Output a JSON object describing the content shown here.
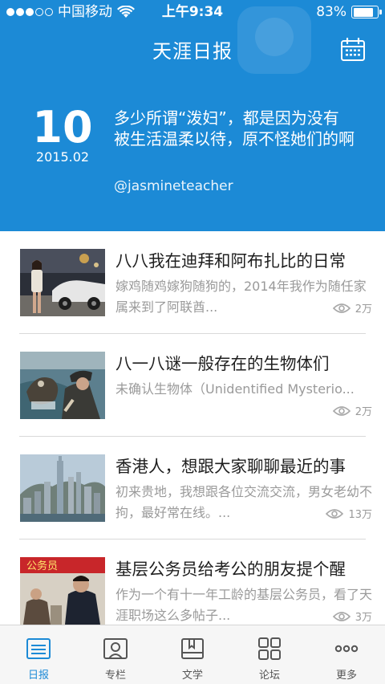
{
  "status_bar": {
    "carrier": "中国移动",
    "time": "上午9:34",
    "battery": "83%",
    "battery_level": 0.83,
    "signal_bars_filled": 3,
    "signal_bars_total": 5
  },
  "header": {
    "title": "天涯日报",
    "background_color": "#1c8ad6",
    "calendar_icon": "calendar-icon"
  },
  "daily": {
    "day": "10",
    "month": "2015.02",
    "quote": "多少所谓“泼妇”，都是因为没有被生活温柔以待，原不怪她们的啊",
    "author": "@jasmineteacher"
  },
  "articles": [
    {
      "title": "八八我在迪拜和阿布扎比的日常",
      "summary": "嫁鸡随鸡嫁狗随狗的，2014年我作为随任家属来到了阿联酋...",
      "views": "2万"
    },
    {
      "title": "八一八谜一般存在的生物体们",
      "summary": "未确认生物体（Unidentified Mysterio...",
      "views": "2万"
    },
    {
      "title": "香港人，想跟大家聊聊最近的事",
      "summary": "初来贵地，我想跟各位交流交流，男女老幼不拘，最好常在线。...",
      "views": "13万"
    },
    {
      "title": "基层公务员给考公的朋友提个醒",
      "summary": "作为一个有十一年工龄的基层公务员，看了天涯职场这么多帖子...",
      "views": "3万"
    }
  ],
  "thumbnail_badge": "公务员",
  "tabs": [
    {
      "label": "日报",
      "icon": "newspaper-icon",
      "active": true
    },
    {
      "label": "专栏",
      "icon": "profile-card-icon",
      "active": false
    },
    {
      "label": "文学",
      "icon": "book-icon",
      "active": false
    },
    {
      "label": "论坛",
      "icon": "grid-icon",
      "active": false
    },
    {
      "label": "更多",
      "icon": "more-dots-icon",
      "active": false
    }
  ],
  "colors": {
    "accent": "#1c8ad6",
    "muted_text": "#9a9a9a"
  }
}
